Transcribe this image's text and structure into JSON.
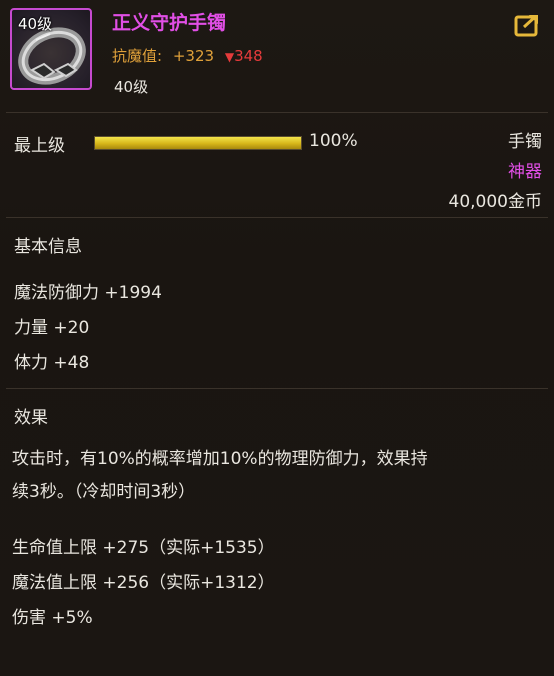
{
  "item": {
    "level_badge": "40级",
    "name": "正义守护手镯",
    "resist_label": "抗魔值:",
    "resist_value": "+323",
    "resist_compare": "348",
    "required_level": "40级"
  },
  "grade": {
    "label": "最上级",
    "percent_text": "100%",
    "percent_value": 100,
    "type": "手镯",
    "rarity": "神器",
    "price": "40,000金币"
  },
  "basic_info": {
    "title": "基本信息",
    "stats": [
      "魔法防御力 +1994",
      "力量 +20",
      "体力 +48"
    ]
  },
  "effect": {
    "title": "效果",
    "description_line1": "攻击时，有10%的概率增加10%的物理防御力，效果持",
    "description_line2": "续3秒。（冷却时间3秒）",
    "stats": [
      "生命值上限 +275（实际+1535）",
      "魔法值上限 +256（实际+1312）",
      "伤害 +5%"
    ]
  },
  "colors": {
    "epic_purple": "#e14fe6",
    "gold_text": "#e0a13a",
    "decrease_red": "#e53b3b",
    "bar_gold": "#e3c52a"
  },
  "icons": {
    "share": "share-icon",
    "item": "bracelet-icon"
  }
}
